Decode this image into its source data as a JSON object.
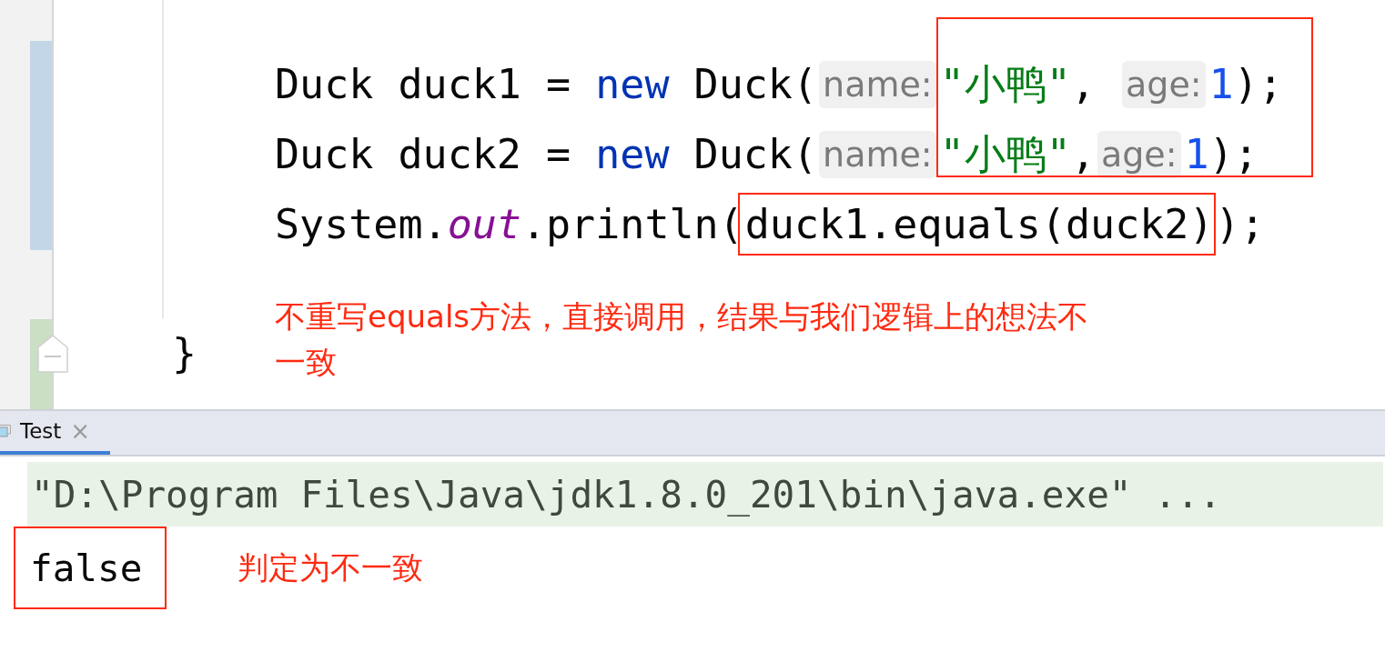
{
  "editor": {
    "lines": [
      {
        "tokens": [
          {
            "kind": "plain",
            "text": "Duck duck1 = "
          },
          {
            "kind": "keyword",
            "text": "new"
          },
          {
            "kind": "plain",
            "text": " Duck("
          },
          {
            "kind": "hint",
            "text": "name:"
          },
          {
            "kind": "string",
            "text": "\"小鸭\""
          },
          {
            "kind": "plain",
            "text": ", "
          },
          {
            "kind": "hint",
            "text": "age:"
          },
          {
            "kind": "number",
            "text": "1"
          },
          {
            "kind": "plain",
            "text": ");"
          }
        ]
      },
      {
        "tokens": [
          {
            "kind": "plain",
            "text": "Duck duck2 = "
          },
          {
            "kind": "keyword",
            "text": "new"
          },
          {
            "kind": "plain",
            "text": " Duck("
          },
          {
            "kind": "hint",
            "text": "name:"
          },
          {
            "kind": "string",
            "text": "\"小鸭\""
          },
          {
            "kind": "plain",
            "text": ","
          },
          {
            "kind": "hint",
            "text": "age:"
          },
          {
            "kind": "number",
            "text": "1"
          },
          {
            "kind": "plain",
            "text": ");"
          }
        ]
      },
      {
        "tokens": [
          {
            "kind": "plain",
            "text": "System."
          },
          {
            "kind": "field",
            "text": "out"
          },
          {
            "kind": "plain",
            "text": ".println("
          },
          {
            "kind": "boxed",
            "text": "duck1.equals(duck2)"
          },
          {
            "kind": "plain",
            "text": ");"
          }
        ]
      }
    ],
    "annotation": "不重写equals方法，直接调用，结果与我们逻辑上的想法不一致",
    "closing_brace": "}"
  },
  "run_panel": {
    "tabs": [
      {
        "label": "Test",
        "selected": true,
        "close": "×"
      }
    ],
    "output": [
      {
        "kind": "command",
        "text": "\"D:\\Program Files\\Java\\jdk1.8.0_201\\bin\\java.exe\" ..."
      },
      {
        "kind": "result",
        "text": "false"
      }
    ],
    "annotation": "判定为不一致"
  }
}
